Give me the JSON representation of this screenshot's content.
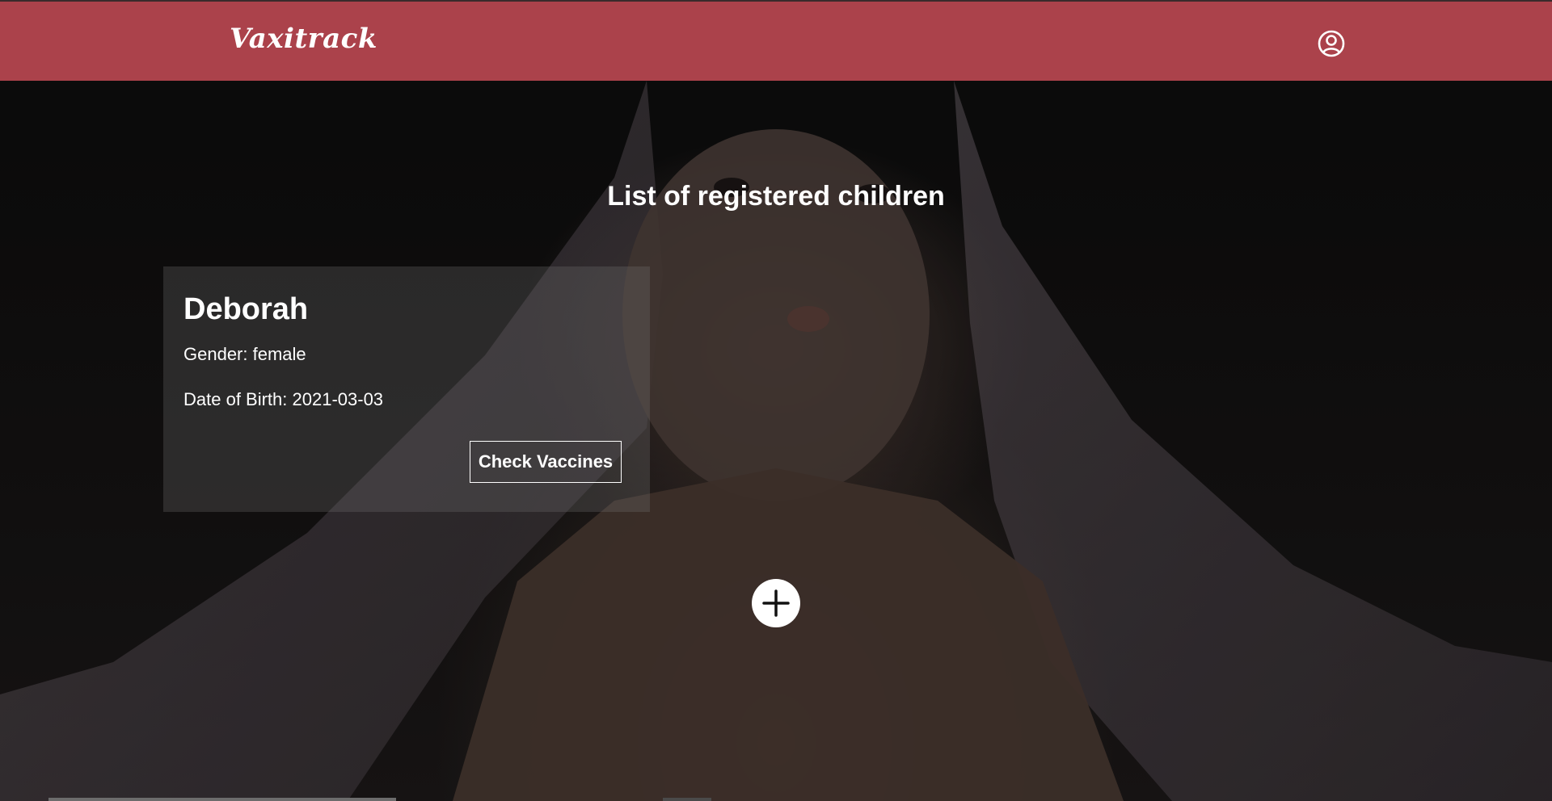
{
  "navbar": {
    "brand": "Vaxitrack",
    "profile_icon": "user-circle-icon",
    "color": "#ab424b"
  },
  "main": {
    "title": "List of registered children",
    "children": [
      {
        "name": "Deborah",
        "gender": "Gender: female",
        "dob": "Date of Birth: 2021-03-03",
        "action_label": "Check Vaccines"
      }
    ],
    "add_icon": "plus-icon"
  }
}
